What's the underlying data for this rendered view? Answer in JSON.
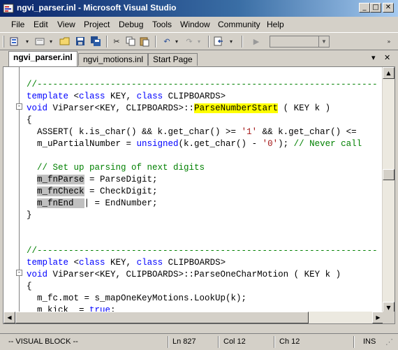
{
  "window": {
    "title": "ngvi_parser.inl - Microsoft Visual Studio",
    "controls": {
      "minimize": "_",
      "maximize": "□",
      "close": "✕"
    }
  },
  "menu": {
    "items": [
      "File",
      "Edit",
      "View",
      "Project",
      "Debug",
      "Tools",
      "Window",
      "Community",
      "Help"
    ]
  },
  "toolbar": {
    "buttons": [
      "new-project-icon",
      "add-item-icon",
      "open-file-icon",
      "save-icon",
      "save-all-icon",
      "cut-icon",
      "copy-icon",
      "paste-icon",
      "undo-icon",
      "redo-icon",
      "navigate-backward-icon",
      "start-debug-icon"
    ],
    "combo_value": ""
  },
  "tabs": [
    {
      "label": "ngvi_parser.inl",
      "active": true
    },
    {
      "label": "ngvi_motions.inl",
      "active": false
    },
    {
      "label": "Start Page",
      "active": false
    }
  ],
  "tab_controls": {
    "dropdown": "▾",
    "close": "✕"
  },
  "code": {
    "lines": [
      {
        "segments": [
          {
            "t": ""
          }
        ]
      },
      {
        "segments": [
          {
            "t": "//-----------------------------------------------------------------",
            "c": "cm"
          }
        ]
      },
      {
        "segments": [
          {
            "t": "template",
            "c": "kw"
          },
          {
            "t": " <"
          },
          {
            "t": "class",
            "c": "kw"
          },
          {
            "t": " KEY, "
          },
          {
            "t": "class",
            "c": "kw"
          },
          {
            "t": " CLIPBOARDS>"
          }
        ]
      },
      {
        "segments": [
          {
            "t": "void",
            "c": "kw"
          },
          {
            "t": " ViParser<KEY, CLIPBOARDS>::"
          },
          {
            "t": "ParseNumberStart",
            "c": "hl-yellow"
          },
          {
            "t": " ( KEY k )"
          }
        ]
      },
      {
        "segments": [
          {
            "t": "{"
          }
        ]
      },
      {
        "segments": [
          {
            "t": "  ASSERT( k.is_char() && k.get_char() >= "
          },
          {
            "t": "'1'",
            "c": "st"
          },
          {
            "t": " && k.get_char() <= "
          }
        ]
      },
      {
        "segments": [
          {
            "t": "  m_uPartialNumber = "
          },
          {
            "t": "unsigned",
            "c": "kw"
          },
          {
            "t": "(k.get_char() - "
          },
          {
            "t": "'0'",
            "c": "st"
          },
          {
            "t": "); "
          },
          {
            "t": "// Never call",
            "c": "cm"
          }
        ]
      },
      {
        "segments": [
          {
            "t": ""
          }
        ]
      },
      {
        "segments": [
          {
            "t": "  "
          },
          {
            "t": "// Set up parsing of next digits",
            "c": "cm"
          }
        ]
      },
      {
        "segments": [
          {
            "t": "  "
          },
          {
            "t": "m_fnParse",
            "c": "hl-gray"
          },
          {
            "t": " = ParseDigit;"
          }
        ]
      },
      {
        "segments": [
          {
            "t": "  "
          },
          {
            "t": "m_fnCheck",
            "c": "hl-gray"
          },
          {
            "t": " = CheckDigit;"
          }
        ]
      },
      {
        "segments": [
          {
            "t": "  "
          },
          {
            "t": "m_fnEnd  ",
            "c": "hl-gray"
          },
          {
            "t": "| = EndNumber;"
          }
        ]
      },
      {
        "segments": [
          {
            "t": "}"
          }
        ]
      },
      {
        "segments": [
          {
            "t": ""
          }
        ]
      },
      {
        "segments": [
          {
            "t": ""
          }
        ]
      },
      {
        "segments": [
          {
            "t": "//-----------------------------------------------------------------",
            "c": "cm"
          }
        ]
      },
      {
        "segments": [
          {
            "t": "template",
            "c": "kw"
          },
          {
            "t": " <"
          },
          {
            "t": "class",
            "c": "kw"
          },
          {
            "t": " KEY, "
          },
          {
            "t": "class",
            "c": "kw"
          },
          {
            "t": " CLIPBOARDS>"
          }
        ]
      },
      {
        "segments": [
          {
            "t": "void",
            "c": "kw"
          },
          {
            "t": " ViParser<KEY, CLIPBOARDS>::ParseOneCharMotion ( KEY k )"
          }
        ]
      },
      {
        "segments": [
          {
            "t": "{"
          }
        ]
      },
      {
        "segments": [
          {
            "t": "  m_fc.mot = s_mapOneKeyMotions.LookUp(k);"
          }
        ]
      },
      {
        "segments": [
          {
            "t": "  m_kick  = "
          },
          {
            "t": "true",
            "c": "kw"
          },
          {
            "t": ";"
          }
        ]
      },
      {
        "segments": [
          {
            "t": "}"
          }
        ]
      }
    ]
  },
  "status": {
    "mode": "-- VISUAL BLOCK --",
    "line": "Ln 827",
    "col": "Col 12",
    "ch": "Ch 12",
    "ins": "INS"
  }
}
